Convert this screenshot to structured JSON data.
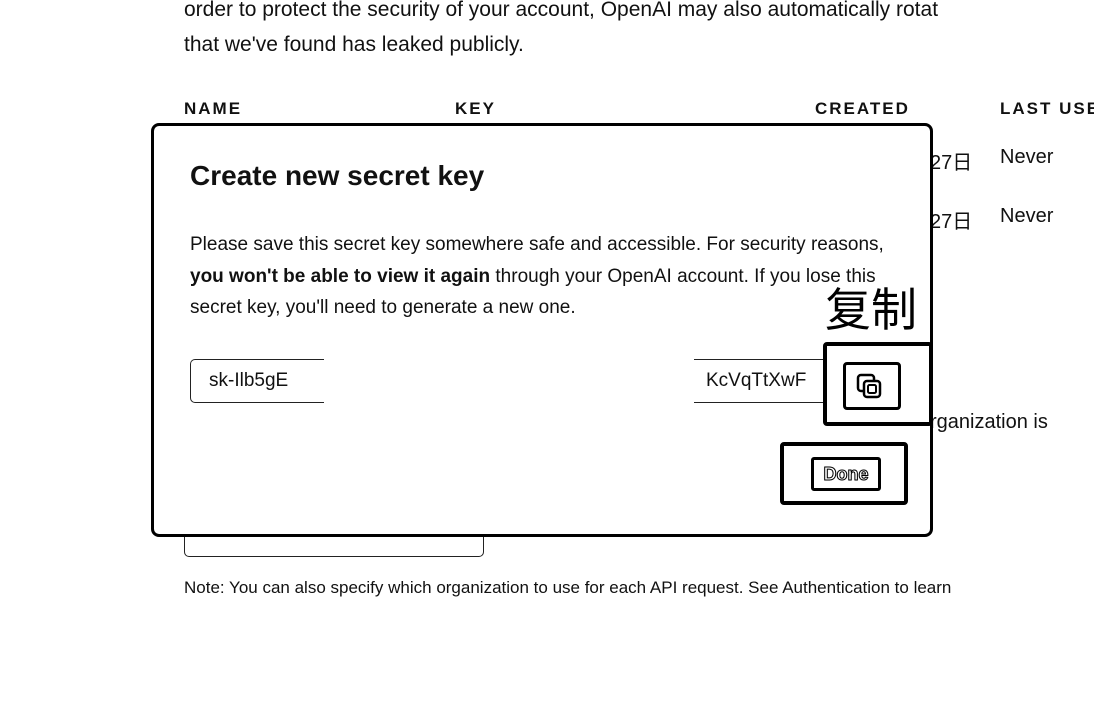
{
  "background": {
    "intro_line1": "order to protect the security of your account, OpenAI may also automatically rotat",
    "intro_line2": "that we've found has leaked publicly.",
    "table": {
      "headers": [
        "NAME",
        "KEY",
        "CREATED",
        "LAST USE"
      ],
      "rows": [
        {
          "created_tail": "27日",
          "last_used": "Never"
        },
        {
          "created_tail": "27日",
          "last_used": "Never"
        }
      ]
    },
    "org_text_tail": "rganization is",
    "note": "Note: You can also specify which organization to use for each API request. See Authentication to learn"
  },
  "modal": {
    "title": "Create new secret key",
    "desc_part1": "Please save this secret key somewhere safe and accessible. For security reasons, ",
    "desc_bold": "you won't be able to view it again",
    "desc_part2": " through your OpenAI account. If you lose this secret key, you'll need to generate a new one.",
    "key_left": "sk-Ilb5gE",
    "key_right": "KcVqTtXwF",
    "copy_label": "复制",
    "done_label": "Done"
  },
  "colors": {
    "text": "#111111",
    "border": "#000000",
    "background": "#ffffff"
  },
  "icons": {
    "copy": "copy-icon"
  }
}
